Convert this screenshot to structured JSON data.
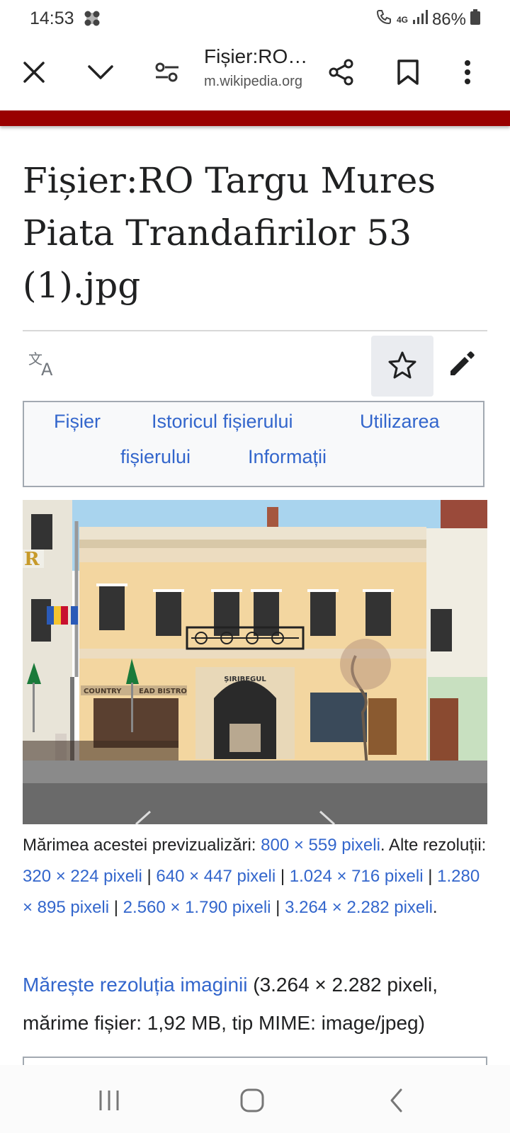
{
  "status": {
    "time": "14:53",
    "network": "4G",
    "battery": "86%"
  },
  "browser": {
    "tab_title": "Fișier:RO…",
    "domain": "m.wikipedia.org"
  },
  "page": {
    "title": "Fișier:RO Targu Mures Piata Trandafirilor 53 (1).jpg",
    "tabs": [
      "Fișier",
      "Istoricul fișierului",
      "Utilizarea",
      "fișierului",
      "Informații"
    ]
  },
  "image": {
    "alt": "RO Targu Mures Piata Trandafirilor 53 (1).jpg",
    "sign_left": "COUNTRY",
    "sign_right": "EAD BISTRO",
    "arch_sign": "ȘIRIBEGUL"
  },
  "caption": {
    "prefix": "Mărimea acestei previzualizări: ",
    "preview": "800 × 559 pixeli",
    "mid": ". Alte rezoluții: ",
    "res1": "320 × 224 pixeli",
    "sep": " | ",
    "res2": "640 × 447 pixeli",
    "res3": "1.024 × 716 pixeli",
    "res4": "1.280 × 895 pixeli",
    "res5": "2.560 × 1.790 pixeli",
    "res6": "3.264 × 2.282 pixeli",
    "end": "."
  },
  "full_res": {
    "link": "Mărește rezoluția imaginii",
    "details": " (3.264 × 2.282 pixeli, mărime fișier: 1,92 MB, tip MIME: image/jpeg)"
  },
  "icons": {
    "close": "close-icon",
    "collapse": "chevron-down-icon",
    "site_settings": "tune-icon",
    "share": "share-icon",
    "bookmark": "bookmark-icon",
    "menu": "more-vertical-icon",
    "language": "translate-icon",
    "watch": "star-icon",
    "edit": "pencil-icon"
  },
  "colors": {
    "accent_bar": "#990000",
    "link": "#3366cc",
    "tabs_bg": "#f8f9fa"
  }
}
